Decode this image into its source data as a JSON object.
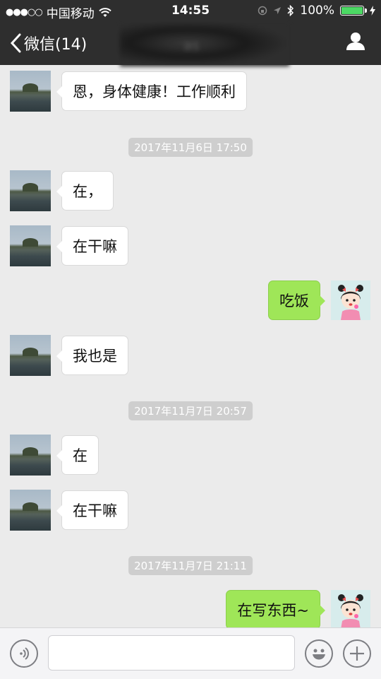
{
  "status_bar": {
    "signal": "●●●○○",
    "carrier": "中国移动",
    "time": "14:55",
    "battery": "100%"
  },
  "nav": {
    "back_label": "微信(14)",
    "title_obscured": "as"
  },
  "messages": [
    {
      "type": "received",
      "text": "恩，身体健康！工作顺利"
    },
    {
      "type": "time",
      "text": "2017年11月6日 17:50"
    },
    {
      "type": "received",
      "text": "在，"
    },
    {
      "type": "received",
      "text": "在干嘛"
    },
    {
      "type": "sent",
      "text": "吃饭"
    },
    {
      "type": "received",
      "text": "我也是"
    },
    {
      "type": "time",
      "text": "2017年11月7日 20:57"
    },
    {
      "type": "received",
      "text": "在"
    },
    {
      "type": "received",
      "text": "在干嘛"
    },
    {
      "type": "time",
      "text": "2017年11月7日 21:11"
    },
    {
      "type": "sent",
      "text": "在写东西~"
    }
  ],
  "colors": {
    "nav_bg": "#2e2e2e",
    "chat_bg": "#ebebeb",
    "sent_bubble": "#9fe658",
    "received_bubble": "#ffffff",
    "battery": "#4cd964"
  },
  "icons": {
    "voice": "voice-icon",
    "emoji": "emoji-icon",
    "plus": "plus-icon",
    "profile": "person-icon",
    "back": "chevron-left-icon"
  }
}
